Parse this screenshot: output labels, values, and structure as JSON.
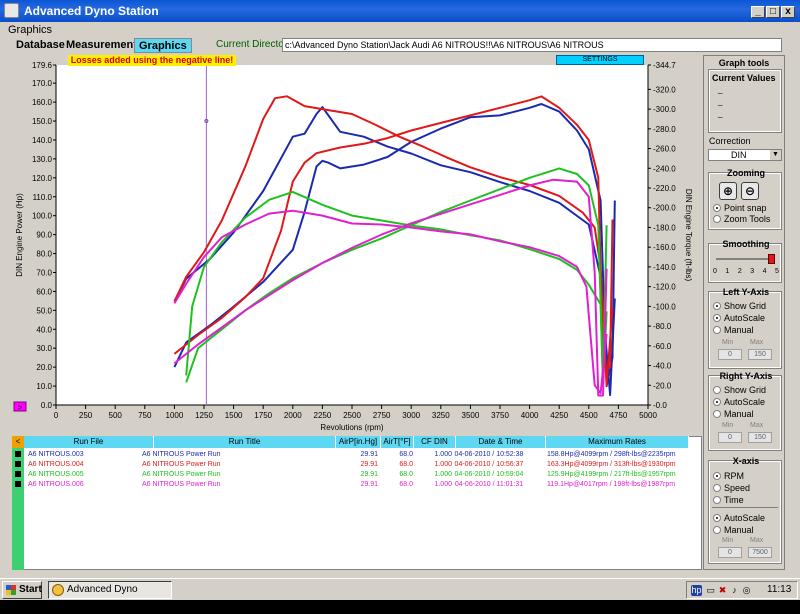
{
  "window": {
    "title": "Advanced Dyno Station"
  },
  "menu": {
    "items": [
      "Graphics"
    ]
  },
  "toolbar": {
    "tabs": [
      "Database",
      "Measurements",
      "Graphics"
    ],
    "dir_label": "Current Directory",
    "dir_value": "c:\\Advanced Dyno Station\\Jack Audi A6 NITROUS!!\\A6 NITROUS\\A6 NITROUS"
  },
  "plot": {
    "notice": "Losses added using the negative line!",
    "settings_label": "SETTINGS",
    "marker_label": ">"
  },
  "chart_data": {
    "type": "line",
    "xlabel": "Revolutions (rpm)",
    "ylabel": "DIN Engine Power (Hp)",
    "y2label": "DIN Engine Torque (ft-lbs)",
    "xlim": [
      0,
      5000
    ],
    "ylim": [
      0,
      179.6
    ],
    "y2lim": [
      0,
      344.7
    ],
    "grid": false,
    "x_ticks": [
      "0",
      "250",
      "500",
      "750",
      "1000",
      "1250",
      "1500",
      "1750",
      "2000",
      "2250",
      "2500",
      "2750",
      "3000",
      "3250",
      "3500",
      "3750",
      "4000",
      "4250",
      "4500",
      "4750",
      "5000"
    ],
    "y_ticks": [
      "0.0",
      "10.0",
      "20.0",
      "30.0",
      "40.0",
      "50.0",
      "60.0",
      "70.0",
      "80.0",
      "90.0",
      "100.0",
      "110.0",
      "120.0",
      "130.0",
      "140.0",
      "150.0",
      "160.0",
      "170.0",
      "179.6"
    ],
    "y2_ticks": [
      "0.0",
      "20.0",
      "40.0",
      "60.0",
      "80.0",
      "100.0",
      "120.0",
      "140.0",
      "160.0",
      "180.0",
      "200.0",
      "220.0",
      "240.0",
      "260.0",
      "280.0",
      "300.0",
      "320.0",
      "344.7"
    ],
    "cursor_rpm": 1270,
    "series": [
      {
        "name": "A6 NITROUS.003",
        "color": "#1a2ab0",
        "power": [
          [
            1000,
            20
          ],
          [
            1100,
            33
          ],
          [
            1300,
            42
          ],
          [
            1500,
            52
          ],
          [
            1750,
            65
          ],
          [
            2000,
            82
          ],
          [
            2100,
            102
          ],
          [
            2200,
            126
          ],
          [
            2250,
            129
          ],
          [
            2300,
            128
          ],
          [
            2400,
            125
          ],
          [
            2600,
            127
          ],
          [
            2800,
            131
          ],
          [
            3000,
            139
          ],
          [
            3250,
            146
          ],
          [
            3500,
            152
          ],
          [
            3750,
            153
          ],
          [
            4000,
            157
          ],
          [
            4100,
            159
          ],
          [
            4250,
            155
          ],
          [
            4400,
            145
          ],
          [
            4500,
            135
          ],
          [
            4600,
            108
          ],
          [
            4650,
            10
          ],
          [
            4700,
            25
          ],
          [
            4720,
            108
          ]
        ],
        "torque": [
          [
            1000,
            105
          ],
          [
            1100,
            128
          ],
          [
            1300,
            148
          ],
          [
            1500,
            175
          ],
          [
            1750,
            217
          ],
          [
            2000,
            272
          ],
          [
            2100,
            275
          ],
          [
            2200,
            295
          ],
          [
            2250,
            302
          ],
          [
            2400,
            277
          ],
          [
            2600,
            272
          ],
          [
            2800,
            262
          ],
          [
            3000,
            255
          ],
          [
            3250,
            243
          ],
          [
            3500,
            236
          ],
          [
            3750,
            226
          ],
          [
            4000,
            217
          ],
          [
            4250,
            205
          ],
          [
            4500,
            183
          ],
          [
            4600,
            130
          ],
          [
            4680,
            10
          ],
          [
            4720,
            108
          ]
        ]
      },
      {
        "name": "A6 NITROUS.004",
        "color": "#e01818",
        "power": [
          [
            1000,
            27
          ],
          [
            1200,
            37
          ],
          [
            1400,
            46
          ],
          [
            1600,
            57
          ],
          [
            1750,
            67
          ],
          [
            1900,
            92
          ],
          [
            2000,
            118
          ],
          [
            2100,
            128
          ],
          [
            2200,
            133
          ],
          [
            2400,
            136
          ],
          [
            2600,
            138
          ],
          [
            2800,
            141
          ],
          [
            3000,
            145
          ],
          [
            3250,
            149
          ],
          [
            3500,
            153
          ],
          [
            3750,
            157
          ],
          [
            4000,
            161
          ],
          [
            4100,
            163
          ],
          [
            4250,
            157
          ],
          [
            4400,
            148
          ],
          [
            4500,
            140
          ],
          [
            4580,
            120
          ],
          [
            4620,
            20
          ],
          [
            4680,
            20
          ],
          [
            4700,
            98
          ]
        ],
        "torque": [
          [
            1000,
            105
          ],
          [
            1100,
            130
          ],
          [
            1250,
            155
          ],
          [
            1400,
            187
          ],
          [
            1600,
            242
          ],
          [
            1750,
            290
          ],
          [
            1850,
            311
          ],
          [
            1950,
            313
          ],
          [
            2100,
            303
          ],
          [
            2300,
            299
          ],
          [
            2500,
            295
          ],
          [
            2700,
            284
          ],
          [
            2900,
            272
          ],
          [
            3100,
            262
          ],
          [
            3300,
            251
          ],
          [
            3500,
            241
          ],
          [
            3750,
            231
          ],
          [
            4000,
            223
          ],
          [
            4250,
            212
          ],
          [
            4450,
            195
          ],
          [
            4550,
            180
          ],
          [
            4600,
            140
          ],
          [
            4650,
            20
          ],
          [
            4700,
            98
          ]
        ]
      },
      {
        "name": "A6 NITROUS.005",
        "color": "#20c020",
        "power": [
          [
            1100,
            12
          ],
          [
            1200,
            30
          ],
          [
            1400,
            40
          ],
          [
            1600,
            50
          ],
          [
            1800,
            59
          ],
          [
            2000,
            67
          ],
          [
            2250,
            75
          ],
          [
            2500,
            82
          ],
          [
            2750,
            88
          ],
          [
            3000,
            95
          ],
          [
            3250,
            102
          ],
          [
            3500,
            108
          ],
          [
            3750,
            114
          ],
          [
            4000,
            120
          ],
          [
            4250,
            125
          ],
          [
            4400,
            122
          ],
          [
            4500,
            116
          ],
          [
            4580,
            95
          ],
          [
            4620,
            12
          ],
          [
            4650,
            95
          ]
        ],
        "torque": [
          [
            1100,
            30
          ],
          [
            1150,
            100
          ],
          [
            1250,
            140
          ],
          [
            1400,
            165
          ],
          [
            1600,
            190
          ],
          [
            1800,
            208
          ],
          [
            2000,
            216
          ],
          [
            2250,
            203
          ],
          [
            2500,
            192
          ],
          [
            2750,
            187
          ],
          [
            3000,
            182
          ],
          [
            3250,
            178
          ],
          [
            3500,
            172
          ],
          [
            3750,
            167
          ],
          [
            4000,
            158
          ],
          [
            4250,
            148
          ],
          [
            4400,
            137
          ],
          [
            4500,
            122
          ],
          [
            4600,
            102
          ],
          [
            4620,
            20
          ],
          [
            4650,
            95
          ]
        ]
      },
      {
        "name": "A6 NITROUS.006",
        "color": "#e020d0",
        "power": [
          [
            1000,
            22
          ],
          [
            1200,
            32
          ],
          [
            1400,
            41
          ],
          [
            1600,
            50
          ],
          [
            1800,
            58
          ],
          [
            2000,
            66
          ],
          [
            2250,
            75
          ],
          [
            2500,
            83
          ],
          [
            2750,
            90
          ],
          [
            3000,
            96
          ],
          [
            3250,
            101
          ],
          [
            3500,
            106
          ],
          [
            3750,
            111
          ],
          [
            4000,
            116
          ],
          [
            4200,
            119
          ],
          [
            4400,
            118
          ],
          [
            4500,
            110
          ],
          [
            4550,
            70
          ],
          [
            4580,
            5
          ],
          [
            4620,
            5
          ],
          [
            4650,
            72
          ]
        ],
        "torque": [
          [
            1000,
            103
          ],
          [
            1100,
            123
          ],
          [
            1250,
            150
          ],
          [
            1400,
            170
          ],
          [
            1600,
            183
          ],
          [
            1800,
            194
          ],
          [
            2000,
            197
          ],
          [
            2250,
            192
          ],
          [
            2500,
            184
          ],
          [
            2750,
            183
          ],
          [
            3000,
            180
          ],
          [
            3250,
            176
          ],
          [
            3500,
            173
          ],
          [
            3750,
            166
          ],
          [
            4000,
            160
          ],
          [
            4250,
            151
          ],
          [
            4400,
            140
          ],
          [
            4480,
            120
          ],
          [
            4550,
            20
          ],
          [
            4600,
            12
          ],
          [
            4650,
            72
          ]
        ]
      }
    ]
  },
  "side": {
    "title": "Graph tools",
    "current_values": {
      "title": "Current Values",
      "lines": [
        "_",
        "_",
        "_"
      ]
    },
    "correction": {
      "label": "Correction",
      "value": "DIN"
    },
    "zooming": {
      "title": "Zooming",
      "options": [
        "Point snap",
        "Zoom Tools"
      ],
      "selected": 0
    },
    "smoothing": {
      "title": "Smoothing",
      "ticks": [
        "0",
        "1",
        "2",
        "3",
        "4",
        "5"
      ],
      "value": 5
    },
    "left_y": {
      "title": "Left Y-Axis",
      "options": [
        "Show Grid",
        "AutoScale",
        "Manual"
      ],
      "checked": [
        0,
        1
      ],
      "min_label": "Min",
      "max_label": "Max",
      "min": "0",
      "max": "150"
    },
    "right_y": {
      "title": "Right Y-Axis",
      "options": [
        "Show Grid",
        "AutoScale",
        "Manual"
      ],
      "checked": [
        1
      ],
      "min_label": "Min",
      "max_label": "Max",
      "min": "0",
      "max": "150"
    },
    "x_axis": {
      "title": "X-axis",
      "options": [
        "RPM",
        "Speed",
        "Time"
      ],
      "selected": 0,
      "scale_options": [
        "AutoScale",
        "Manual"
      ],
      "scale_selected": 0,
      "min_label": "Min",
      "max_label": "Max",
      "min": "0",
      "max": "7500"
    }
  },
  "table": {
    "collapse_label": "<",
    "headers": [
      "Run File",
      "Run Title",
      "AirP[in.Hg]",
      "AirT[°F]",
      "CF DIN",
      "Date & Time",
      "Maximum Rates"
    ],
    "rows": [
      {
        "color": "#1a2ab0",
        "cells": [
          "A6 NITROUS.003",
          "A6 NITROUS Power Run",
          "29.91",
          "68.0",
          "1.000",
          "04-06-2010 / 10:52:38",
          "158.8Hp@4099rpm / 298ft-lbs@2235rpm"
        ]
      },
      {
        "color": "#e01818",
        "cells": [
          "A6 NITROUS.004",
          "A6 NITROUS Power Run",
          "29.91",
          "68.0",
          "1.000",
          "04-06-2010 / 10:56:37",
          "163.3Hp@4099rpm / 313ft-lbs@1930rpm"
        ]
      },
      {
        "color": "#20c020",
        "cells": [
          "A6 NITROUS.005",
          "A6 NITROUS Power Run",
          "29.91",
          "68.0",
          "1.000",
          "04-06-2010 / 10:59:04",
          "125.9Hp@4199rpm / 217ft-lbs@1957rpm"
        ]
      },
      {
        "color": "#e020d0",
        "cells": [
          "A6 NITROUS.006",
          "A6 NITROUS Power Run",
          "29.91",
          "68.0",
          "1.000",
          "04-06-2010 / 11:01:31",
          "119.1Hp@4017rpm / 198ft-lbs@1987rpm"
        ]
      }
    ]
  },
  "taskbar": {
    "start": "Start",
    "app": "Advanced Dyno Station",
    "clock": "11:13"
  }
}
